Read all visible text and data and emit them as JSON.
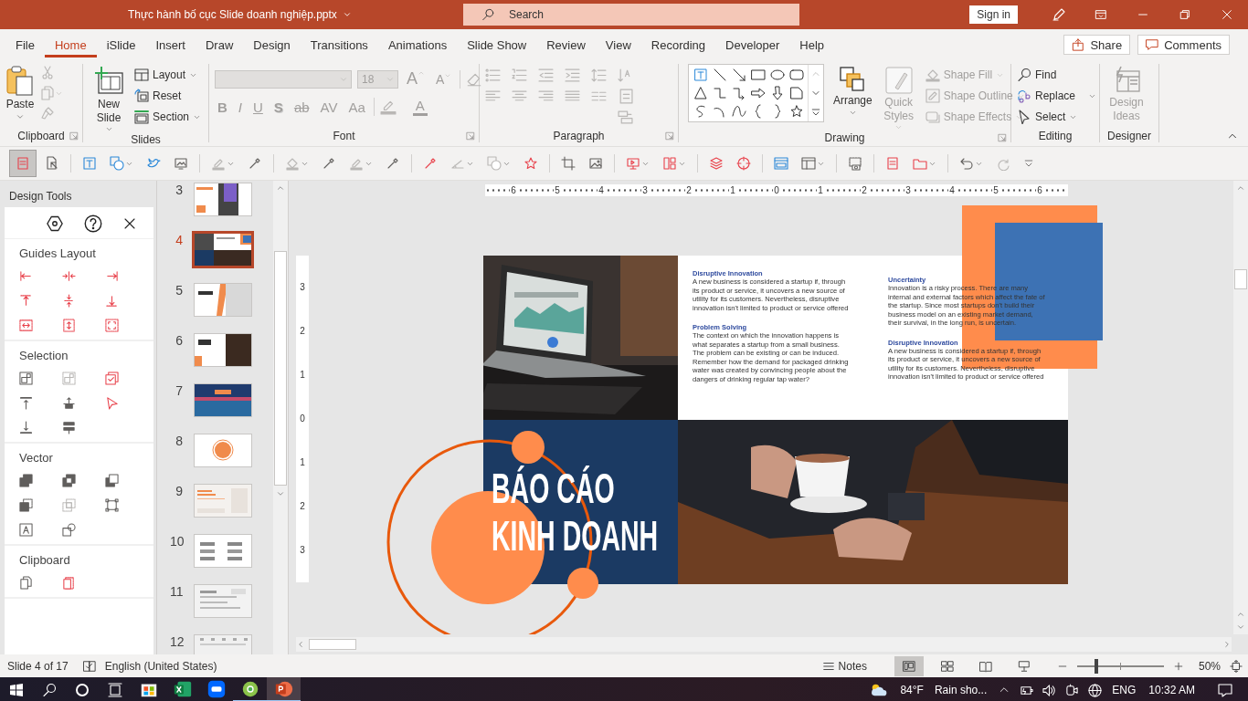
{
  "window": {
    "title": "Thực hành bố cục Slide doanh nghiệp.pptx",
    "search_placeholder": "Search",
    "sign_in": "Sign in"
  },
  "menu": [
    {
      "label": "File",
      "selected": false
    },
    {
      "label": "Home",
      "selected": true
    },
    {
      "label": "iSlide",
      "selected": false
    },
    {
      "label": "Insert",
      "selected": false
    },
    {
      "label": "Draw",
      "selected": false
    },
    {
      "label": "Design",
      "selected": false
    },
    {
      "label": "Transitions",
      "selected": false
    },
    {
      "label": "Animations",
      "selected": false
    },
    {
      "label": "Slide Show",
      "selected": false
    },
    {
      "label": "Review",
      "selected": false
    },
    {
      "label": "View",
      "selected": false
    },
    {
      "label": "Recording",
      "selected": false
    },
    {
      "label": "Developer",
      "selected": false
    },
    {
      "label": "Help",
      "selected": false
    }
  ],
  "share": "Share",
  "comments": "Comments",
  "ribbon": [
    {
      "kind": "clipboard",
      "label": "Clipboard",
      "paste": "Paste"
    },
    {
      "kind": "slides",
      "label": "Slides",
      "new_slide": "New Slide",
      "items": [
        "Layout",
        "Reset",
        "Section"
      ]
    },
    {
      "kind": "font",
      "label": "Font",
      "font_size": "18",
      "disabled": true,
      "size_buttons": [
        {
          "label": "A",
          "kind": "grow"
        },
        {
          "label": "A",
          "kind": "shrink"
        }
      ],
      "buttons": [
        {
          "label": "B",
          "kind": "bold"
        },
        {
          "label": "I",
          "kind": "italic"
        },
        {
          "label": "U",
          "kind": "underline"
        },
        {
          "label": "S",
          "kind": "shadow"
        },
        {
          "label": "ab",
          "kind": "strike"
        },
        {
          "label": "AV",
          "kind": "spacing"
        },
        {
          "label": "Aa",
          "kind": "case"
        }
      ],
      "color_button": "A"
    },
    {
      "kind": "paragraph",
      "label": "Paragraph"
    },
    {
      "kind": "drawing",
      "label": "Drawing",
      "arrange": "Arrange",
      "quick_styles": {
        "label": "Quick Styles",
        "disabled": true
      },
      "shape_items": [
        {
          "label": "Shape Fill",
          "disabled": true
        },
        {
          "label": "Shape Outline",
          "disabled": true
        },
        {
          "label": "Shape Effects",
          "disabled": true
        }
      ]
    },
    {
      "kind": "editing",
      "label": "Editing",
      "items": [
        "Find",
        "Replace",
        "Select"
      ]
    },
    {
      "kind": "designer",
      "label": "Designer",
      "design_ideas": {
        "label": "Design Ideas",
        "disabled": true
      }
    }
  ],
  "design_tools": {
    "title": "Design Tools",
    "sections": [
      {
        "kind": "guides",
        "heading": "Guides Layout"
      },
      {
        "kind": "selection",
        "heading": "Selection"
      },
      {
        "kind": "vector",
        "heading": "Vector"
      },
      {
        "kind": "clipboard",
        "heading": "Clipboard"
      }
    ]
  },
  "thumbnails": [
    {
      "number": "3",
      "selected": false
    },
    {
      "number": "4",
      "selected": true
    },
    {
      "number": "5",
      "selected": false
    },
    {
      "number": "6",
      "selected": false
    },
    {
      "number": "7",
      "selected": false
    },
    {
      "number": "8",
      "selected": false
    },
    {
      "number": "9",
      "selected": false
    },
    {
      "number": "10",
      "selected": false
    },
    {
      "number": "11",
      "selected": false
    },
    {
      "number": "12",
      "selected": false
    }
  ],
  "rulers": {
    "horizontal": [
      "6",
      "5",
      "4",
      "3",
      "2",
      "1",
      "0",
      "1",
      "2",
      "3",
      "4",
      "5",
      "6"
    ],
    "vertical": [
      "3",
      "2",
      "1",
      "0",
      "1",
      "2",
      "3"
    ]
  },
  "slide": {
    "title": [
      "BÁO CÁO",
      "KINH DOANH"
    ],
    "columns": [
      {
        "blocks": [
          {
            "heading": "Disruptive Innovation",
            "body": "A new business is considered a startup if, through its product or service, it uncovers a new source of utility for its customers. Nevertheless, disruptive innovation isn't limited to product or service offered"
          },
          {
            "heading": "Problem Solving",
            "body": "The context on which the innovation happens is what separates a startup from a small business. The problem can be existing or can be induced. Remember how the demand for packaged drinking water was created by convincing people about the dangers of drinking regular tap water?"
          }
        ]
      },
      {
        "blocks": [
          {
            "heading": "Uncertainty",
            "body": "Innovation is a risky process. There are many internal and external factors which affect the fate of the startup. Since most startups don't build their business model on an existing market demand, their survival, in the long run, is uncertain."
          },
          {
            "heading": "Disruptive Innovation",
            "body": "A new business is considered a startup if, through its product or service, it uncovers a new source of utility for its customers. Nevertheless, disruptive innovation isn't limited to product or service offered"
          }
        ]
      }
    ]
  },
  "status_bar": {
    "slide": "Slide 4 of 17",
    "language": "English (United States)",
    "notes": "Notes",
    "views": [
      {
        "selected": true
      },
      {
        "selected": false
      },
      {
        "selected": false
      },
      {
        "selected": false
      }
    ],
    "zoom_slider": {
      "level": 0.22
    },
    "zoom": "50%"
  },
  "taskbar": {
    "apps": [
      {
        "kind": "store",
        "running": false,
        "active": false
      },
      {
        "kind": "excel",
        "running": false,
        "active": false
      },
      {
        "kind": "zalo",
        "running": false,
        "active": false
      },
      {
        "kind": "browser",
        "running": true,
        "active": false
      },
      {
        "kind": "powerpoint",
        "running": true,
        "active": true
      }
    ],
    "temperature": "84°F",
    "weather": "Rain sho...",
    "language": "ENG",
    "time": "10:32 AM"
  }
}
